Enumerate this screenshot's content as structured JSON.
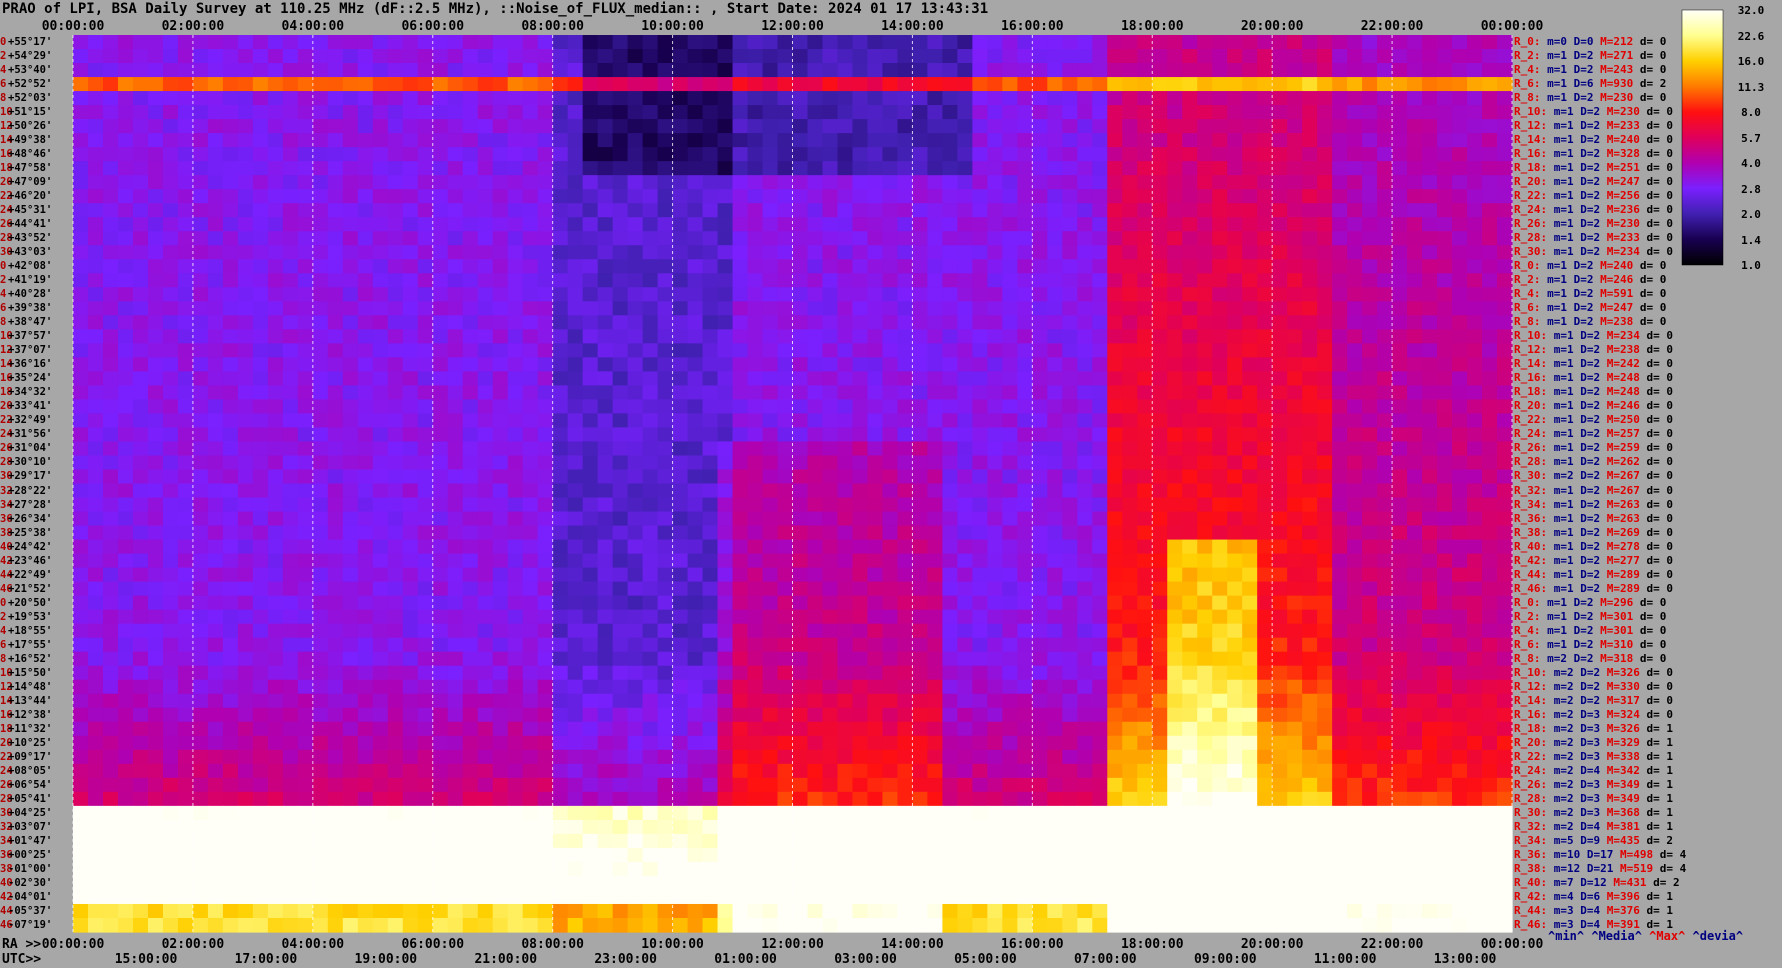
{
  "title": "PRAO of LPI, BSA Daily Survey at 110.25 MHz (dF::2.5 MHz), ::Noise_of_FLUX_median:: , Start Date: 2024 01 17 13:43:31",
  "chart_data": {
    "type": "heatmap",
    "title": "PRAO of LPI, BSA Daily Survey at 110.25 MHz (dF::2.5 MHz), ::Noise_of_FLUX_median:: , Start Date: 2024 01 17 13:43:31",
    "x_top_label": "",
    "x_top_ticks": [
      "00:00:00",
      "02:00:00",
      "04:00:00",
      "06:00:00",
      "08:00:00",
      "10:00:00",
      "12:00:00",
      "14:00:00",
      "16:00:00",
      "18:00:00",
      "20:00:00",
      "22:00:00",
      "00:00:00"
    ],
    "x_bottom_ra_label": "RA >>",
    "x_bottom_ra_ticks": [
      "00:00:00",
      "02:00:00",
      "04:00:00",
      "06:00:00",
      "08:00:00",
      "10:00:00",
      "12:00:00",
      "14:00:00",
      "16:00:00",
      "18:00:00",
      "20:00:00",
      "22:00:00",
      "00:00:00"
    ],
    "x_bottom_utc_label": "UTC>>",
    "x_bottom_utc_ticks": [
      "15:00:00",
      "17:00:00",
      "19:00:00",
      "21:00:00",
      "23:00:00",
      "01:00:00",
      "03:00:00",
      "05:00:00",
      "07:00:00",
      "09:00:00",
      "11:00:00",
      "13:00:00"
    ],
    "y_ticks": [
      "+55°17'",
      "+54°29'",
      "+53°40'",
      "+52°52'",
      "+52°03'",
      "+51°15'",
      "+50°26'",
      "+49°38'",
      "+48°46'",
      "+47°58'",
      "+47°09'",
      "+46°20'",
      "+45°31'",
      "+44°41'",
      "+43°52'",
      "+43°03'",
      "+42°08'",
      "+41°19'",
      "+40°28'",
      "+39°38'",
      "+38°47'",
      "+37°57'",
      "+37°07'",
      "+36°16'",
      "+35°24'",
      "+34°32'",
      "+33°41'",
      "+32°49'",
      "+31°56'",
      "+31°04'",
      "+30°10'",
      "+29°17'",
      "+28°22'",
      "+27°28'",
      "+26°34'",
      "+25°38'",
      "+24°42'",
      "+23°46'",
      "+22°49'",
      "+21°52'",
      "+20°50'",
      "+19°53'",
      "+18°55'",
      "+17°55'",
      "+16°52'",
      "+15°50'",
      "+14°48'",
      "+13°44'",
      "+12°38'",
      "+11°32'",
      "+10°25'",
      "+09°17'",
      "+08°05'",
      "+06°54'",
      "+05°41'",
      "+04°25'",
      "+03°07'",
      "+01°47'",
      "+00°25'",
      "-01°00'",
      "-02°30'",
      "-04°01'",
      "-05°37'",
      "-07°19'"
    ],
    "row_index_labels": [
      "0",
      "2",
      "4",
      "6",
      "8",
      "10",
      "12",
      "14",
      "16",
      "18",
      "20",
      "22",
      "24",
      "26",
      "28",
      "30",
      "0",
      "2",
      "4",
      "6",
      "8",
      "10",
      "12",
      "14",
      "16",
      "18",
      "20",
      "22",
      "24",
      "26",
      "28",
      "30",
      "32",
      "34",
      "36",
      "38",
      "40",
      "42",
      "44",
      "46",
      "0",
      "2",
      "4",
      "6",
      "8",
      "10",
      "12",
      "14",
      "16",
      "18",
      "20",
      "22",
      "24",
      "26",
      "28",
      "30",
      "32",
      "34",
      "36",
      "38",
      "40",
      "42",
      "44",
      "46"
    ],
    "colorbar": {
      "ticks": [
        "32.0",
        "22.6",
        "16.0",
        "11.3",
        "8.0",
        "5.7",
        "4.0",
        "2.8",
        "2.0",
        "1.4",
        "1.0"
      ],
      "stops": [
        "#fffff8",
        "#ffff90",
        "#ffd000",
        "#ff7a00",
        "#ff1010",
        "#e0005a",
        "#b000b0",
        "#7a20ff",
        "#4020b0",
        "#180050",
        "#000000"
      ]
    },
    "stats": [
      {
        "r": "R_0:",
        "m": "m=0",
        "D": "D=0",
        "M": "M=212",
        "d": "d= 0"
      },
      {
        "r": "R_2:",
        "m": "m=1",
        "D": "D=2",
        "M": "M=271",
        "d": "d= 0"
      },
      {
        "r": "R_4:",
        "m": "m=1",
        "D": "D=2",
        "M": "M=243",
        "d": "d= 0"
      },
      {
        "r": "R_6:",
        "m": "m=1",
        "D": "D=6",
        "M": "M=930",
        "d": "d= 2"
      },
      {
        "r": "R_8:",
        "m": "m=1",
        "D": "D=2",
        "M": "M=230",
        "d": "d= 0"
      },
      {
        "r": "R_10:",
        "m": "m=1",
        "D": "D=2",
        "M": "M=230",
        "d": "d= 0"
      },
      {
        "r": "R_12:",
        "m": "m=1",
        "D": "D=2",
        "M": "M=233",
        "d": "d= 0"
      },
      {
        "r": "R_14:",
        "m": "m=1",
        "D": "D=2",
        "M": "M=240",
        "d": "d= 0"
      },
      {
        "r": "R_16:",
        "m": "m=1",
        "D": "D=2",
        "M": "M=328",
        "d": "d= 0"
      },
      {
        "r": "R_18:",
        "m": "m=1",
        "D": "D=2",
        "M": "M=251",
        "d": "d= 0"
      },
      {
        "r": "R_20:",
        "m": "m=1",
        "D": "D=2",
        "M": "M=247",
        "d": "d= 0"
      },
      {
        "r": "R_22:",
        "m": "m=1",
        "D": "D=2",
        "M": "M=256",
        "d": "d= 0"
      },
      {
        "r": "R_24:",
        "m": "m=1",
        "D": "D=2",
        "M": "M=236",
        "d": "d= 0"
      },
      {
        "r": "R_26:",
        "m": "m=1",
        "D": "D=2",
        "M": "M=230",
        "d": "d= 0"
      },
      {
        "r": "R_28:",
        "m": "m=1",
        "D": "D=2",
        "M": "M=233",
        "d": "d= 0"
      },
      {
        "r": "R_30:",
        "m": "m=1",
        "D": "D=2",
        "M": "M=234",
        "d": "d= 0"
      },
      {
        "r": "R_0:",
        "m": "m=1",
        "D": "D=2",
        "M": "M=240",
        "d": "d= 0"
      },
      {
        "r": "R_2:",
        "m": "m=1",
        "D": "D=2",
        "M": "M=246",
        "d": "d= 0"
      },
      {
        "r": "R_4:",
        "m": "m=1",
        "D": "D=2",
        "M": "M=591",
        "d": "d= 0"
      },
      {
        "r": "R_6:",
        "m": "m=1",
        "D": "D=2",
        "M": "M=247",
        "d": "d= 0"
      },
      {
        "r": "R_8:",
        "m": "m=1",
        "D": "D=2",
        "M": "M=238",
        "d": "d= 0"
      },
      {
        "r": "R_10:",
        "m": "m=1",
        "D": "D=2",
        "M": "M=234",
        "d": "d= 0"
      },
      {
        "r": "R_12:",
        "m": "m=1",
        "D": "D=2",
        "M": "M=238",
        "d": "d= 0"
      },
      {
        "r": "R_14:",
        "m": "m=1",
        "D": "D=2",
        "M": "M=242",
        "d": "d= 0"
      },
      {
        "r": "R_16:",
        "m": "m=1",
        "D": "D=2",
        "M": "M=248",
        "d": "d= 0"
      },
      {
        "r": "R_18:",
        "m": "m=1",
        "D": "D=2",
        "M": "M=248",
        "d": "d= 0"
      },
      {
        "r": "R_20:",
        "m": "m=1",
        "D": "D=2",
        "M": "M=246",
        "d": "d= 0"
      },
      {
        "r": "R_22:",
        "m": "m=1",
        "D": "D=2",
        "M": "M=250",
        "d": "d= 0"
      },
      {
        "r": "R_24:",
        "m": "m=1",
        "D": "D=2",
        "M": "M=257",
        "d": "d= 0"
      },
      {
        "r": "R_26:",
        "m": "m=1",
        "D": "D=2",
        "M": "M=259",
        "d": "d= 0"
      },
      {
        "r": "R_28:",
        "m": "m=1",
        "D": "D=2",
        "M": "M=262",
        "d": "d= 0"
      },
      {
        "r": "R_30:",
        "m": "m=2",
        "D": "D=2",
        "M": "M=267",
        "d": "d= 0"
      },
      {
        "r": "R_32:",
        "m": "m=1",
        "D": "D=2",
        "M": "M=267",
        "d": "d= 0"
      },
      {
        "r": "R_34:",
        "m": "m=1",
        "D": "D=2",
        "M": "M=263",
        "d": "d= 0"
      },
      {
        "r": "R_36:",
        "m": "m=1",
        "D": "D=2",
        "M": "M=263",
        "d": "d= 0"
      },
      {
        "r": "R_38:",
        "m": "m=1",
        "D": "D=2",
        "M": "M=269",
        "d": "d= 0"
      },
      {
        "r": "R_40:",
        "m": "m=1",
        "D": "D=2",
        "M": "M=278",
        "d": "d= 0"
      },
      {
        "r": "R_42:",
        "m": "m=1",
        "D": "D=2",
        "M": "M=277",
        "d": "d= 0"
      },
      {
        "r": "R_44:",
        "m": "m=1",
        "D": "D=2",
        "M": "M=289",
        "d": "d= 0"
      },
      {
        "r": "R_46:",
        "m": "m=1",
        "D": "D=2",
        "M": "M=289",
        "d": "d= 0"
      },
      {
        "r": "R_0:",
        "m": "m=1",
        "D": "D=2",
        "M": "M=296",
        "d": "d= 0"
      },
      {
        "r": "R_2:",
        "m": "m=1",
        "D": "D=2",
        "M": "M=301",
        "d": "d= 0"
      },
      {
        "r": "R_4:",
        "m": "m=1",
        "D": "D=2",
        "M": "M=301",
        "d": "d= 0"
      },
      {
        "r": "R_6:",
        "m": "m=1",
        "D": "D=2",
        "M": "M=310",
        "d": "d= 0"
      },
      {
        "r": "R_8:",
        "m": "m=2",
        "D": "D=2",
        "M": "M=318",
        "d": "d= 0"
      },
      {
        "r": "R_10:",
        "m": "m=2",
        "D": "D=2",
        "M": "M=326",
        "d": "d= 0"
      },
      {
        "r": "R_12:",
        "m": "m=2",
        "D": "D=2",
        "M": "M=330",
        "d": "d= 0"
      },
      {
        "r": "R_14:",
        "m": "m=2",
        "D": "D=2",
        "M": "M=317",
        "d": "d= 0"
      },
      {
        "r": "R_16:",
        "m": "m=2",
        "D": "D=3",
        "M": "M=324",
        "d": "d= 0"
      },
      {
        "r": "R_18:",
        "m": "m=2",
        "D": "D=3",
        "M": "M=326",
        "d": "d= 1"
      },
      {
        "r": "R_20:",
        "m": "m=2",
        "D": "D=3",
        "M": "M=329",
        "d": "d= 1"
      },
      {
        "r": "R_22:",
        "m": "m=2",
        "D": "D=3",
        "M": "M=338",
        "d": "d= 1"
      },
      {
        "r": "R_24:",
        "m": "m=2",
        "D": "D=4",
        "M": "M=342",
        "d": "d= 1"
      },
      {
        "r": "R_26:",
        "m": "m=2",
        "D": "D=3",
        "M": "M=349",
        "d": "d= 1"
      },
      {
        "r": "R_28:",
        "m": "m=2",
        "D": "D=3",
        "M": "M=349",
        "d": "d= 1"
      },
      {
        "r": "R_30:",
        "m": "m=2",
        "D": "D=3",
        "M": "M=368",
        "d": "d= 1"
      },
      {
        "r": "R_32:",
        "m": "m=2",
        "D": "D=4",
        "M": "M=381",
        "d": "d= 1"
      },
      {
        "r": "R_34:",
        "m": "m=5",
        "D": "D=9",
        "M": "M=435",
        "d": "d= 2"
      },
      {
        "r": "R_36:",
        "m": "m=10",
        "D": "D=17",
        "M": "M=498",
        "d": "d= 4"
      },
      {
        "r": "R_38:",
        "m": "m=12",
        "D": "D=21",
        "M": "M=519",
        "d": "d= 4"
      },
      {
        "r": "R_40:",
        "m": "m=7",
        "D": "D=12",
        "M": "M=431",
        "d": "d= 2"
      },
      {
        "r": "R_42:",
        "m": "m=4",
        "D": "D=6",
        "M": "M=396",
        "d": "d= 1"
      },
      {
        "r": "R_44:",
        "m": "m=3",
        "D": "D=4",
        "M": "M=376",
        "d": "d= 1"
      },
      {
        "r": "R_46:",
        "m": "m=3",
        "D": "D=4",
        "M": "M=391",
        "d": "d= 1"
      }
    ],
    "stats_caption": {
      "min": "^min^",
      "median": "^Media^",
      "max": "^Max^",
      "devia": "^devia^"
    }
  }
}
